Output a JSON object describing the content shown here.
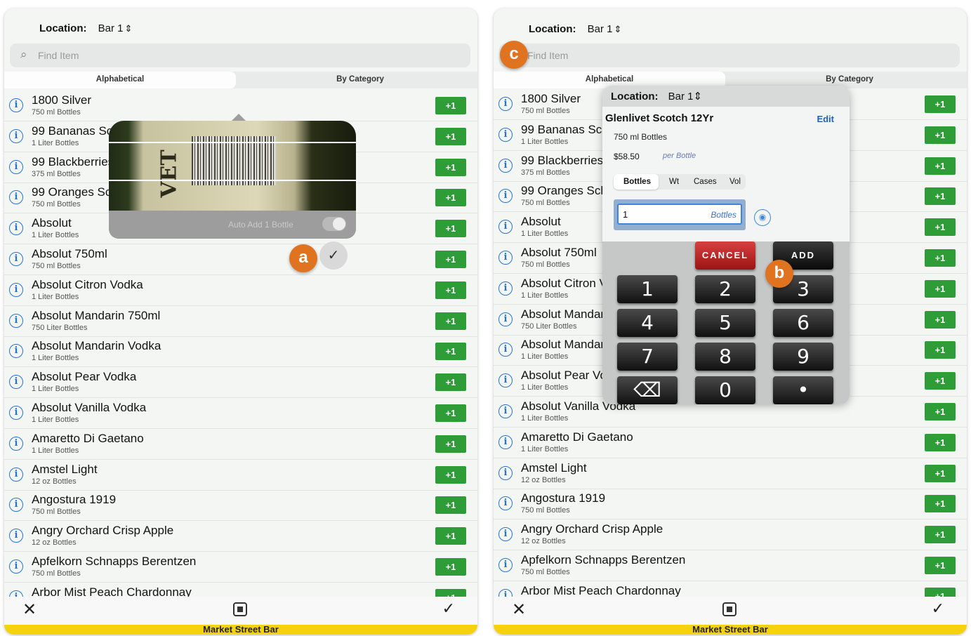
{
  "location_label": "Location:",
  "location_value": "Bar 1",
  "search_placeholder": "Find Item",
  "tabs": [
    "Alphabetical",
    "By Category"
  ],
  "plus_label": "+1",
  "items": [
    {
      "name": "1800 Silver",
      "unit": "750 ml Bottles"
    },
    {
      "name": "99 Bananas Schnapps",
      "unit": "1 Liter Bottles"
    },
    {
      "name": "99 Blackberries",
      "unit": "375 ml Bottles"
    },
    {
      "name": "99 Oranges Schnapps",
      "unit": "750 ml Bottles"
    },
    {
      "name": "Absolut",
      "unit": "1 Liter Bottles"
    },
    {
      "name": "Absolut 750ml",
      "unit": "750 ml Bottles"
    },
    {
      "name": "Absolut Citron Vodka",
      "unit": "1 Liter Bottles"
    },
    {
      "name": "Absolut Mandarin 750ml",
      "unit": "750 Liter Bottles"
    },
    {
      "name": "Absolut Mandarin Vodka",
      "unit": "1 Liter Bottles"
    },
    {
      "name": "Absolut Pear Vodka",
      "unit": "1 Liter Bottles"
    },
    {
      "name": "Absolut Vanilla Vodka",
      "unit": "1 Liter Bottles"
    },
    {
      "name": "Amaretto Di Gaetano",
      "unit": "1 Liter Bottles"
    },
    {
      "name": "Amstel Light",
      "unit": "12 oz Bottles"
    },
    {
      "name": "Angostura 1919",
      "unit": "750 ml Bottles"
    },
    {
      "name": "Angry Orchard Crisp Apple",
      "unit": "12 oz Bottles"
    },
    {
      "name": "Apfelkorn Schnapps Berentzen",
      "unit": "750 ml Bottles"
    },
    {
      "name": "Arbor Mist Peach Chardonnay",
      "unit": ""
    }
  ],
  "footer": "Market Street Bar",
  "icons": {
    "info": "info-icon",
    "search": "search-icon",
    "close": "close-icon",
    "scan": "scan-icon",
    "check": "checkmark-icon",
    "mic": "voice-icon"
  },
  "camera": {
    "auto_add_label": "Auto Add 1 Bottle",
    "label_text": "VET"
  },
  "callouts": {
    "a": "a",
    "b": "b",
    "c": "c"
  },
  "popup": {
    "location_label": "Location:",
    "location_value": "Bar 1",
    "item_name": "Glenlivet Scotch 12Yr",
    "edit_label": "Edit",
    "item_size": "750 ml Bottles",
    "price": "$58.50",
    "per_label": "per Bottle",
    "unit_tabs": [
      "Bottles",
      "Wt",
      "Cases",
      "Vol"
    ],
    "qty_value": "1",
    "qty_unit": "Bottles",
    "cancel_label": "CANCEL",
    "add_label": "ADD",
    "keys": [
      "1",
      "2",
      "3",
      "4",
      "5",
      "6",
      "7",
      "8",
      "9",
      "⌫",
      "0",
      "•"
    ]
  },
  "colors": {
    "plus_green": "#2f9d37",
    "callout_orange": "#e0731f",
    "footer_yellow": "#f5d20c",
    "cancel_red": "#c62a2a"
  }
}
